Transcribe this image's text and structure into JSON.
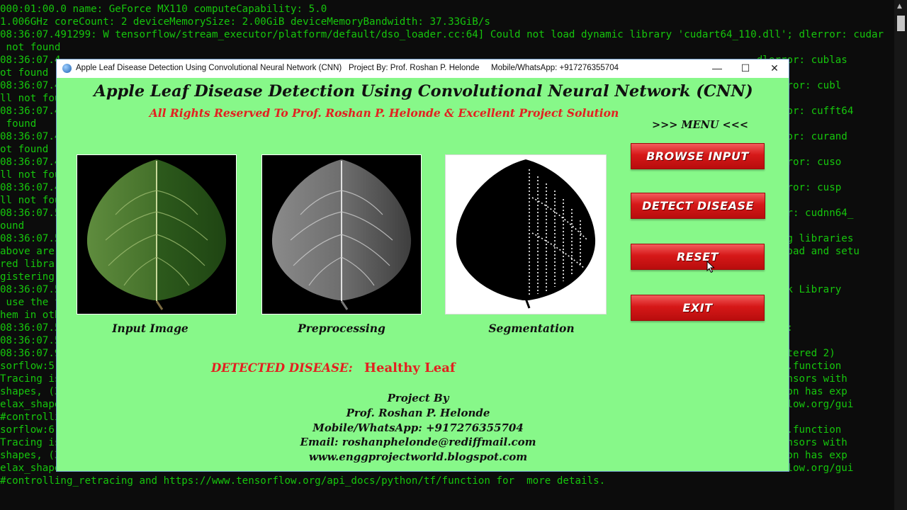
{
  "console": {
    "lines": [
      "000:01:00.0 name: GeForce MX110 computeCapability: 5.0",
      "1.006GHz coreCount: 2 deviceMemorySize: 2.00GiB deviceMemoryBandwidth: 37.33GiB/s",
      "08:36:07.491299: W tensorflow/stream_executor/platform/default/dso_loader.cc:64] Could not load dynamic library 'cudart64_110.dll'; dlerror: cudar",
      " not found",
      "08:36:07.4                                                                                                                   dlerror: cublas",
      "ot found",
      "08:36:07.4                                                                                                                 '; dlerror: cubl",
      "ll not fou",
      "08:36:07.4                                                                                                                   dlerror: cufft64",
      " found",
      "08:36:07.4                                                                                                                   dlerror: curand",
      "ot found",
      "08:36:07.4                                                                                                                 '; dlerror: cuso",
      "ll not fou",
      "08:36:07.4                                                                                                                 '; dlerror: cusp",
      "ll not fou",
      "08:36:07.5                                                                                                                  dlerror: cudnn64_",
      "ound",
      "08:36:07.5                                                                                                                  missing libraries",
      "above are                                                                                                                    download and setu",
      "red librar",
      "gistering",
      "08:36:07.5                                                                                                                  Network Library",
      " use the f",
      "hem in oth",
      "08:36:07.5                                                                                                                  matrix:",
      "08:36:07.5",
      "08:36:07.9                                                                                                                  (registered 2)",
      "sorflow:5                                                                                                                   red tf.function",
      "Tracing is                                                                                                                  ing tensors with",
      "shapes, (3                                                                                                                  function has exp",
      "elax_shape                                                                                                                  ensorflow.org/gui",
      "#controlli",
      "sorflow:6                                                                                                                   red tf.function",
      "Tracing is                                                                                                                  ing tensors with",
      "shapes, (3                                                                                                                  function has exp",
      "elax_shape                                                                                                                  ensorflow.org/gui",
      "#controlling_retracing and https://www.tensorflow.org/api_docs/python/tf/function for  more details."
    ]
  },
  "window": {
    "title": "Apple Leaf Disease Detection Using Convolutional Neural Network (CNN)",
    "project_by": "Project By: Prof. Roshan P. Helonde",
    "mobile": "Mobile/WhatsApp: +917276355704",
    "minimize_glyph": "—",
    "maximize_glyph": "☐",
    "close_glyph": "✕"
  },
  "app": {
    "main_title": "Apple Leaf Disease Detection Using Convolutional Neural Network (CNN)",
    "rights": "All Rights Reserved To Prof. Roshan P. Helonde & Excellent Project Solution",
    "menu_title": ">>> MENU <<<",
    "images": [
      {
        "label": "Input Image",
        "icon": "leaf-color-image"
      },
      {
        "label": "Preprocessing",
        "icon": "leaf-grayscale-image"
      },
      {
        "label": "Segmentation",
        "icon": "leaf-binary-image"
      }
    ],
    "buttons": {
      "browse": "BROWSE INPUT",
      "detect": "DETECT DISEASE",
      "reset": "RESET",
      "exit": "EXIT"
    },
    "detected_label": "DETECTED DISEASE:",
    "detected_value": "Healthy Leaf",
    "credits": {
      "heading": "Project By",
      "name": "Prof. Roshan P. Helonde",
      "mobile": "Mobile/WhatsApp: +917276355704",
      "email": "Email: roshanphelonde@rediffmail.com",
      "website": "www.enggprojectworld.blogspot.com"
    }
  },
  "colors": {
    "console_text": "#16c60c",
    "window_bg": "#87f889",
    "accent_red": "#e32020",
    "button_red": "#d61818"
  }
}
